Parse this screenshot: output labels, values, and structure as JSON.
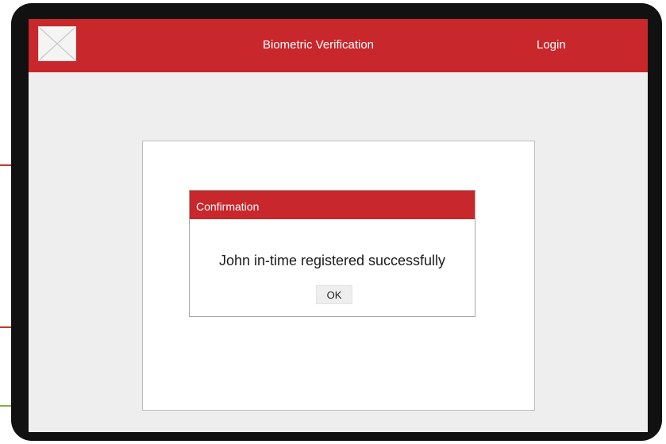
{
  "header": {
    "title": "Biometric Verification",
    "login_label": "Login",
    "logo_icon": "image-placeholder-icon",
    "background_color": "#c8272c"
  },
  "dialog": {
    "title": "Confirmation",
    "message": "John in-time registered successfully",
    "ok_label": "OK",
    "title_bar_color": "#c8272c"
  },
  "colors": {
    "screen_background": "#eeeeee",
    "device_frame": "#111111",
    "panel_background": "#ffffff"
  }
}
